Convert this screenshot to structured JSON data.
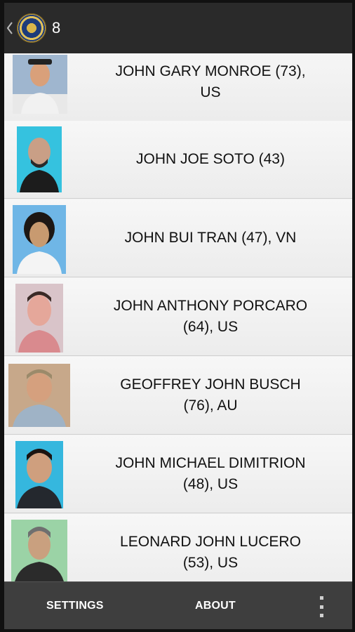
{
  "app_bar": {
    "back_icon": "chevron-left-icon",
    "logo_icon": "fbi-seal-icon",
    "count": "8"
  },
  "list": {
    "items": [
      {
        "name": "JOHN GARY MONROE (73),\nUS",
        "photo_bg": "#9fb6cf"
      },
      {
        "name": "JOHN JOE SOTO (43)",
        "photo_bg": "#35c2df"
      },
      {
        "name": "JOHN BUI TRAN (47), VN",
        "photo_bg": "#6fb6e6"
      },
      {
        "name": "JOHN ANTHONY PORCARO\n(64), US",
        "photo_bg": "#d9c4c9"
      },
      {
        "name": "GEOFFREY JOHN BUSCH\n(76), AU",
        "photo_bg": "#c7a88a"
      },
      {
        "name": "JOHN MICHAEL DIMITRION\n(48), US",
        "photo_bg": "#35b7de"
      },
      {
        "name": "LEONARD JOHN LUCERO\n(53), US",
        "photo_bg": "#9bd3a6"
      }
    ]
  },
  "bottom_bar": {
    "settings_label": "SETTINGS",
    "about_label": "ABOUT",
    "overflow_icon": "more-vertical-icon"
  }
}
